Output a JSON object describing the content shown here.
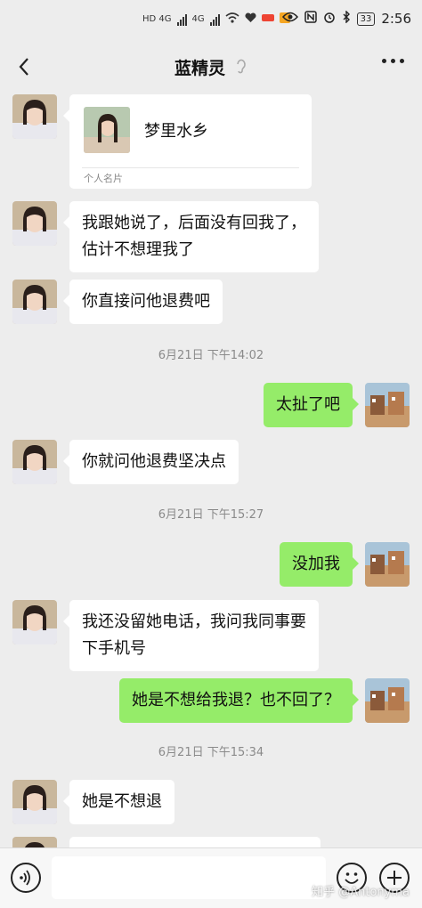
{
  "status_bar": {
    "net_left": "HD 4G",
    "net_mid": "4G",
    "time": "2:56",
    "battery": "33"
  },
  "header": {
    "title": "蓝精灵",
    "ear_icon": "ear-icon",
    "back_icon": "back-arrow-icon",
    "more_icon": "more-dots-icon"
  },
  "messages": [
    {
      "type": "card",
      "side": "in",
      "card_name": "梦里水乡",
      "card_label": "个人名片"
    },
    {
      "type": "text",
      "side": "in",
      "lines": [
        "我跟她说了，后面没有回我了，",
        "估计不想理我了"
      ]
    },
    {
      "type": "text",
      "side": "in",
      "lines": [
        "你直接问他退费吧"
      ]
    },
    {
      "type": "time",
      "text": "6月21日 下午14:02"
    },
    {
      "type": "text",
      "side": "out",
      "lines": [
        "太扯了吧"
      ]
    },
    {
      "type": "text",
      "side": "in",
      "lines": [
        "你就问他退费坚决点"
      ]
    },
    {
      "type": "time",
      "text": "6月21日 下午15:27"
    },
    {
      "type": "text",
      "side": "out",
      "lines": [
        "没加我"
      ]
    },
    {
      "type": "text",
      "side": "in",
      "lines": [
        "我还没留她电话，我问我同事要",
        "下手机号"
      ]
    },
    {
      "type": "text",
      "side": "out",
      "lines": [
        "她是不想给我退？也不回了？"
      ]
    },
    {
      "type": "time",
      "text": "6月21日 下午15:34"
    },
    {
      "type": "text",
      "side": "in",
      "lines": [
        "她是不想退"
      ]
    }
  ],
  "bottom_bar": {
    "voice_icon": "voice-icon",
    "emoji_icon": "emoji-icon",
    "plus_icon": "plus-icon",
    "input_value": ""
  },
  "watermark": "知乎 @Antonyma",
  "colors": {
    "background": "#ededed",
    "outgoing_bubble": "#95ec69",
    "incoming_bubble": "#ffffff",
    "timestamp": "#8a8a8a"
  }
}
